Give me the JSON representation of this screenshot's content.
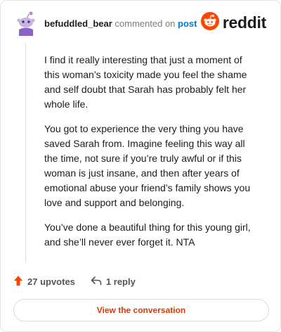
{
  "comment": {
    "username": "befuddled_bear",
    "action_text": "commented on",
    "post_link": "post",
    "avatar_icon": "snoo-avatar-icon",
    "paragraphs": [
      "I find it really interesting that just a moment of this woman’s toxicity made you feel the shame and self doubt that Sarah has probably felt her whole life.",
      "You got to experience the very thing you have saved Sarah from. Imagine feeling this way all the time, not sure if you’re truly awful or if this woman is just insane, and then after years of emotional abuse your friend’s family shows you love and support and belonging.",
      "You’ve done a beautiful thing for this young girl, and she’ll never ever forget it. NTA"
    ]
  },
  "brand": {
    "name": "reddit",
    "logo_icon": "reddit-snoo-icon",
    "color": "#ff4500"
  },
  "actions": {
    "upvotes": "27 upvotes",
    "replies": "1 reply",
    "upvote_icon": "upvote-arrow-icon",
    "reply_icon": "reply-arrow-icon",
    "upvote_color": "#ff4500"
  },
  "cta": {
    "label": "View the conversation",
    "color": "#d93a00"
  }
}
